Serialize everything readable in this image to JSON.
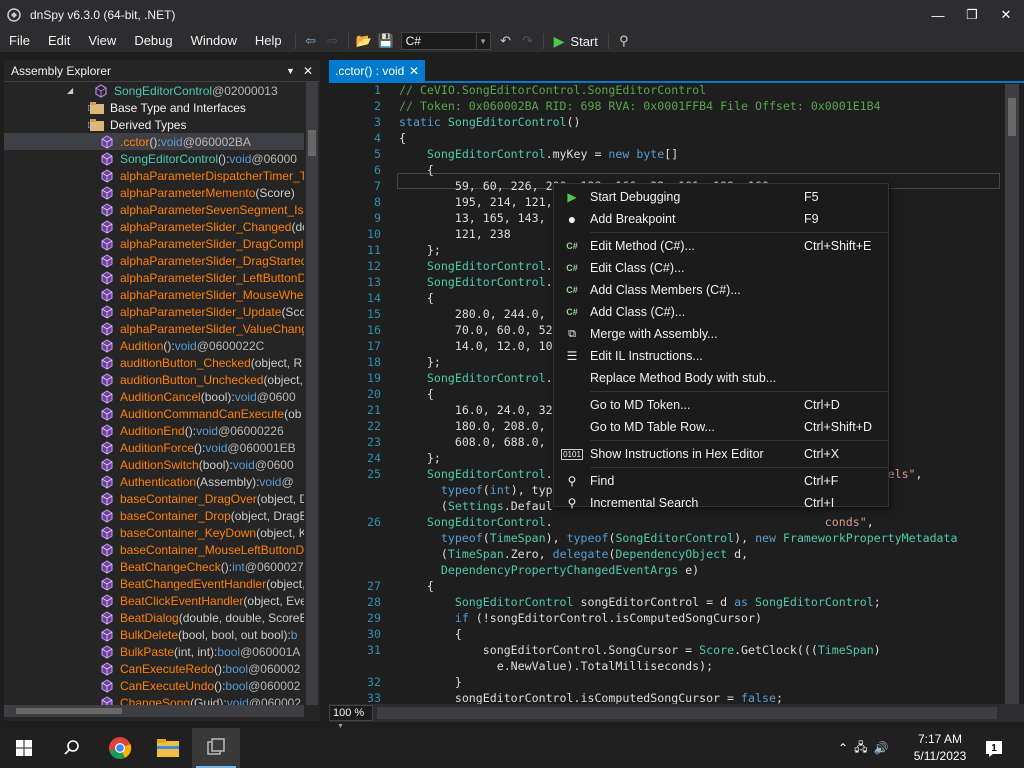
{
  "window": {
    "title": "dnSpy v6.3.0 (64-bit, .NET)"
  },
  "menu": [
    "File",
    "Edit",
    "View",
    "Debug",
    "Window",
    "Help"
  ],
  "toolbar": {
    "language": "C#",
    "start_label": "Start"
  },
  "explorer": {
    "title": "Assembly Explorer",
    "rows": [
      {
        "kind": "class",
        "indent": 90,
        "name": "SongEditorControl",
        "params": "",
        "ret": "",
        "tok": " @02000013"
      },
      {
        "kind": "folder",
        "indent": 86,
        "name": "Base Type and Interfaces",
        "params": "",
        "ret": "",
        "tok": ""
      },
      {
        "kind": "folder",
        "indent": 86,
        "name": "Derived Types",
        "params": "",
        "ret": "",
        "tok": ""
      },
      {
        "kind": "method",
        "indent": 96,
        "name": ".cctor",
        "params": "()",
        "ret": "void",
        "tok": " @060002BA",
        "sel": true
      },
      {
        "kind": "method",
        "indent": 96,
        "name": "SongEditorControl",
        "ctor": true,
        "params": "()",
        "ret": "void",
        "tok": " @06000"
      },
      {
        "kind": "method",
        "indent": 96,
        "name": "alphaParameterDispatcherTimer_Ti",
        "params": "",
        "ret": "",
        "tok": ""
      },
      {
        "kind": "method",
        "indent": 96,
        "name": "alphaParameterMemento",
        "params": "(Score)",
        "ret": "",
        "tok": ""
      },
      {
        "kind": "method",
        "indent": 96,
        "name": "alphaParameterSevenSegment_IsK",
        "params": "",
        "ret": "",
        "tok": ""
      },
      {
        "kind": "method",
        "indent": 96,
        "name": "alphaParameterSlider_Changed",
        "params": "(do",
        "ret": "",
        "tok": ""
      },
      {
        "kind": "method",
        "indent": 96,
        "name": "alphaParameterSlider_DragComple",
        "params": "",
        "ret": "",
        "tok": ""
      },
      {
        "kind": "method",
        "indent": 96,
        "name": "alphaParameterSlider_DragStarted",
        "params": "(",
        "ret": "",
        "tok": ""
      },
      {
        "kind": "method",
        "indent": 96,
        "name": "alphaParameterSlider_LeftButtonD",
        "params": "",
        "ret": "",
        "tok": ""
      },
      {
        "kind": "method",
        "indent": 96,
        "name": "alphaParameterSlider_MouseWhee",
        "params": "",
        "ret": "",
        "tok": ""
      },
      {
        "kind": "method",
        "indent": 96,
        "name": "alphaParameterSlider_Update",
        "params": "(Scor",
        "ret": "",
        "tok": ""
      },
      {
        "kind": "method",
        "indent": 96,
        "name": "alphaParameterSlider_ValueChange",
        "params": "",
        "ret": "",
        "tok": ""
      },
      {
        "kind": "method",
        "indent": 96,
        "name": "Audition",
        "params": "()",
        "ret": "void",
        "tok": " @0600022C"
      },
      {
        "kind": "method",
        "indent": 96,
        "name": "auditionButton_Checked",
        "params": "(object, R",
        "ret": "",
        "tok": ""
      },
      {
        "kind": "method",
        "indent": 96,
        "name": "auditionButton_Unchecked",
        "params": "(object,",
        "ret": "",
        "tok": ""
      },
      {
        "kind": "method",
        "indent": 96,
        "name": "AuditionCancel",
        "params": "(bool)",
        "ret": "void",
        "tok": " @0600"
      },
      {
        "kind": "method",
        "indent": 96,
        "name": "AuditionCommandCanExecute",
        "params": "(ob",
        "ret": "",
        "tok": ""
      },
      {
        "kind": "method",
        "indent": 96,
        "name": "AuditionEnd",
        "params": "()",
        "ret": "void",
        "tok": " @06000226"
      },
      {
        "kind": "method",
        "indent": 96,
        "name": "AuditionForce",
        "params": "()",
        "ret": "void",
        "tok": " @060001EB"
      },
      {
        "kind": "method",
        "indent": 96,
        "name": "AuditionSwitch",
        "params": "(bool)",
        "ret": "void",
        "tok": " @0600"
      },
      {
        "kind": "method",
        "indent": 96,
        "name": "Authentication",
        "params": "(Assembly)",
        "ret": "void",
        "tok": " @"
      },
      {
        "kind": "method",
        "indent": 96,
        "name": "baseContainer_DragOver",
        "params": "(object, D",
        "ret": "",
        "tok": ""
      },
      {
        "kind": "method",
        "indent": 96,
        "name": "baseContainer_Drop",
        "params": "(object, DragE",
        "ret": "",
        "tok": ""
      },
      {
        "kind": "method",
        "indent": 96,
        "name": "baseContainer_KeyDown",
        "params": "(object, K",
        "ret": "",
        "tok": ""
      },
      {
        "kind": "method",
        "indent": 96,
        "name": "baseContainer_MouseLeftButtonD",
        "params": "",
        "ret": "",
        "tok": ""
      },
      {
        "kind": "method",
        "indent": 96,
        "name": "BeatChangeCheck",
        "params": "()",
        "ret": "int",
        "tok": " @0600027"
      },
      {
        "kind": "method",
        "indent": 96,
        "name": "BeatChangedEventHandler",
        "params": "(object,",
        "ret": "",
        "tok": ""
      },
      {
        "kind": "method",
        "indent": 96,
        "name": "BeatClickEventHandler",
        "params": "(object, Eve",
        "ret": "",
        "tok": ""
      },
      {
        "kind": "method",
        "indent": 96,
        "name": "BeatDialog",
        "params": "(double, double, ScoreB",
        "ret": "",
        "tok": ""
      },
      {
        "kind": "method",
        "indent": 96,
        "name": "BulkDelete",
        "params": "(bool, bool, out bool)",
        "ret": "b",
        "tok": ""
      },
      {
        "kind": "method",
        "indent": 96,
        "name": "BulkPaste",
        "params": "(int, int)",
        "ret": "bool",
        "tok": " @060001A"
      },
      {
        "kind": "method",
        "indent": 96,
        "name": "CanExecuteRedo",
        "params": "()",
        "ret": "bool",
        "tok": " @060002"
      },
      {
        "kind": "method",
        "indent": 96,
        "name": "CanExecuteUndo",
        "params": "()",
        "ret": "bool",
        "tok": " @060002"
      },
      {
        "kind": "method",
        "indent": 96,
        "name": "ChangeSong",
        "params": "(Guid)",
        "ret": "void",
        "tok": " @060002"
      }
    ]
  },
  "tab": {
    "label": ".cctor() : void"
  },
  "zoom": "100 %",
  "code_lines": [
    {
      "n": "1",
      "t": [
        [
          "c-com",
          "// CeVIO.SongEditorControl.SongEditorControl"
        ]
      ]
    },
    {
      "n": "2",
      "t": [
        [
          "c-com",
          "// Token: 0x060002BA RID: 698 RVA: 0x0001FFB4 File Offset: 0x0001E1B4"
        ]
      ]
    },
    {
      "n": "3",
      "t": [
        [
          "c-kw",
          "static "
        ],
        [
          "c-ty",
          "SongEditorControl"
        ],
        [
          "",
          "()"
        ]
      ]
    },
    {
      "n": "4",
      "t": [
        [
          "",
          "{"
        ]
      ]
    },
    {
      "n": "5",
      "t": [
        [
          "",
          "    "
        ],
        [
          "c-ty",
          "SongEditorControl"
        ],
        [
          "",
          ".myKey = "
        ],
        [
          "c-kw",
          "new "
        ],
        [
          "c-kw",
          "byte"
        ],
        [
          "",
          "[]"
        ]
      ]
    },
    {
      "n": "6",
      "t": [
        [
          "",
          "    {"
        ]
      ]
    },
    {
      "n": "7",
      "t": [
        [
          "",
          "        59, 60, 226, 200, 138, 166, 32, 101, 199, 160,"
        ]
      ]
    },
    {
      "n": "8",
      "t": [
        [
          "",
          "        195, 214, 121, 1"
        ]
      ]
    },
    {
      "n": "9",
      "t": [
        [
          "",
          "        13, 165, 143, 2"
        ]
      ]
    },
    {
      "n": "10",
      "t": [
        [
          "",
          "        121, 238"
        ]
      ]
    },
    {
      "n": "11",
      "t": [
        [
          "",
          "    };"
        ]
      ]
    },
    {
      "n": "12",
      "t": [
        [
          "",
          "    "
        ],
        [
          "c-ty",
          "SongEditorControl"
        ],
        [
          "",
          "."
        ]
      ]
    },
    {
      "n": "13",
      "t": [
        [
          "",
          "    "
        ],
        [
          "c-ty",
          "SongEditorControl"
        ],
        [
          "",
          "."
        ]
      ]
    },
    {
      "n": "14",
      "t": [
        [
          "",
          "    {"
        ]
      ]
    },
    {
      "n": "15",
      "t": [
        [
          "",
          "        280.0, 244.0,                                        80.0,"
        ]
      ]
    },
    {
      "n": "16",
      "t": [
        [
          "",
          "        70.0, 60.0, 52"
        ]
      ]
    },
    {
      "n": "17",
      "t": [
        [
          "",
          "        14.0, 12.0, 10"
        ]
      ]
    },
    {
      "n": "18",
      "t": [
        [
          "",
          "    };"
        ]
      ]
    },
    {
      "n": "19",
      "t": [
        [
          "",
          "    "
        ],
        [
          "c-ty",
          "SongEditorControl"
        ],
        [
          "",
          "."
        ]
      ]
    },
    {
      "n": "20",
      "t": [
        [
          "",
          "    {"
        ]
      ]
    },
    {
      "n": "21",
      "t": [
        [
          "",
          "        16.0, 24.0, 32"
        ]
      ]
    },
    {
      "n": "22",
      "t": [
        [
          "",
          "        180.0, 208.0,                                      544.0,"
        ]
      ]
    },
    {
      "n": "23",
      "t": [
        [
          "",
          "        608.0, 688.0,"
        ]
      ]
    },
    {
      "n": "24",
      "t": [
        [
          "",
          "    };"
        ]
      ]
    },
    {
      "n": "25",
      "t": [
        [
          "",
          "    "
        ],
        [
          "c-ty",
          "SongEditorControl"
        ],
        [
          "",
          ".                                       ("
        ],
        [
          "c-str",
          "\"UndoLevels\""
        ],
        [
          "",
          ","
        ]
      ]
    },
    {
      "n": "",
      "t": [
        [
          "",
          "      "
        ],
        [
          "c-kw",
          "typeof"
        ],
        [
          "",
          "("
        ],
        [
          "c-kw",
          "int"
        ],
        [
          "",
          "), typ                                        adata"
        ]
      ]
    },
    {
      "n": "",
      "t": [
        [
          "",
          "      ("
        ],
        [
          "c-ty",
          "Settings"
        ],
        [
          "",
          ".Defaul"
        ]
      ]
    },
    {
      "n": "26",
      "t": [
        [
          "",
          "    "
        ],
        [
          "c-ty",
          "SongEditorControl"
        ],
        [
          "",
          ".                                       "
        ],
        [
          "c-str",
          "conds\""
        ],
        [
          "",
          ","
        ]
      ]
    },
    {
      "n": "",
      "t": [
        [
          "",
          "      "
        ],
        [
          "c-kw",
          "typeof"
        ],
        [
          "",
          "("
        ],
        [
          "c-ty",
          "TimeSpan"
        ],
        [
          "",
          "), "
        ],
        [
          "c-kw",
          "typeof"
        ],
        [
          "",
          "("
        ],
        [
          "c-ty",
          "SongEditorControl"
        ],
        [
          "",
          "), "
        ],
        [
          "c-kw",
          "new "
        ],
        [
          "c-ty",
          "FrameworkPropertyMetadata"
        ]
      ]
    },
    {
      "n": "",
      "t": [
        [
          "",
          "      ("
        ],
        [
          "c-ty",
          "TimeSpan"
        ],
        [
          "",
          ".Zero, "
        ],
        [
          "c-kw",
          "delegate"
        ],
        [
          "",
          "("
        ],
        [
          "c-ty",
          "DependencyObject"
        ],
        [
          "",
          " d,"
        ]
      ]
    },
    {
      "n": "",
      "t": [
        [
          "",
          "      "
        ],
        [
          "c-ty",
          "DependencyPropertyChangedEventArgs"
        ],
        [
          "",
          " e)"
        ]
      ]
    },
    {
      "n": "27",
      "t": [
        [
          "",
          "    {"
        ]
      ]
    },
    {
      "n": "28",
      "t": [
        [
          "",
          "        "
        ],
        [
          "c-ty",
          "SongEditorControl"
        ],
        [
          "",
          " songEditorControl = d "
        ],
        [
          "c-kw",
          "as "
        ],
        [
          "c-ty",
          "SongEditorControl"
        ],
        [
          "",
          ";"
        ]
      ]
    },
    {
      "n": "29",
      "t": [
        [
          "",
          "        "
        ],
        [
          "c-kw",
          "if "
        ],
        [
          "",
          "(!songEditorControl.isComputedSongCursor)"
        ]
      ]
    },
    {
      "n": "30",
      "t": [
        [
          "",
          "        {"
        ]
      ]
    },
    {
      "n": "31",
      "t": [
        [
          "",
          "            songEditorControl.SongCursor = "
        ],
        [
          "c-ty",
          "Score"
        ],
        [
          "",
          ".GetClock((("
        ],
        [
          "c-ty",
          "TimeSpan"
        ],
        [
          "",
          ")"
        ]
      ]
    },
    {
      "n": "",
      "t": [
        [
          "",
          "              e.NewValue).TotalMilliseconds);"
        ]
      ]
    },
    {
      "n": "32",
      "t": [
        [
          "",
          "        }"
        ]
      ]
    },
    {
      "n": "33",
      "t": [
        [
          "",
          "        songEditorControl.isComputedSongCursor = "
        ],
        [
          "c-kw",
          "false"
        ],
        [
          "",
          ";"
        ]
      ]
    },
    {
      "n": "34",
      "t": [
        [
          "",
          "        "
        ],
        [
          "c-kw",
          "if "
        ],
        [
          "",
          "((!songEditorControl.IsPlay && !songEditorControl.IsPlaying) ||"
        ]
      ]
    },
    {
      "n": "",
      "t": [
        [
          "",
          "          songEditorControl.IsAutoScrollEnable)"
        ]
      ]
    }
  ],
  "context_menu": [
    {
      "icon": "play-icon",
      "label": "Start Debugging",
      "shortcut": "F5"
    },
    {
      "icon": "breakpoint-icon",
      "label": "Add Breakpoint",
      "shortcut": "F9",
      "sep_after": true
    },
    {
      "icon": "csharp-icon",
      "label": "Edit Method (C#)...",
      "shortcut": "Ctrl+Shift+E"
    },
    {
      "icon": "csharp-icon",
      "label": "Edit Class (C#)...",
      "shortcut": ""
    },
    {
      "icon": "csharp-icon",
      "label": "Add Class Members (C#)...",
      "shortcut": ""
    },
    {
      "icon": "csharp-icon",
      "label": "Add Class (C#)...",
      "shortcut": ""
    },
    {
      "icon": "merge-icon",
      "label": "Merge with Assembly...",
      "shortcut": ""
    },
    {
      "icon": "il-icon",
      "label": "Edit IL Instructions...",
      "shortcut": ""
    },
    {
      "icon": "",
      "label": "Replace Method Body with stub...",
      "shortcut": "",
      "sep_after": true
    },
    {
      "icon": "",
      "label": "Go to MD Token...",
      "shortcut": "Ctrl+D"
    },
    {
      "icon": "",
      "label": "Go to MD Table Row...",
      "shortcut": "Ctrl+Shift+D",
      "sep_after": true
    },
    {
      "icon": "hex-icon",
      "label": "Show Instructions in Hex Editor",
      "shortcut": "Ctrl+X",
      "sep_after": true
    },
    {
      "icon": "search-icon",
      "label": "Find",
      "shortcut": "Ctrl+F"
    },
    {
      "icon": "search-icon",
      "label": "Incremental Search",
      "shortcut": "Ctrl+I"
    }
  ],
  "taskbar": {
    "time": "7:17 AM",
    "date": "5/11/2023",
    "notifications": "1"
  }
}
